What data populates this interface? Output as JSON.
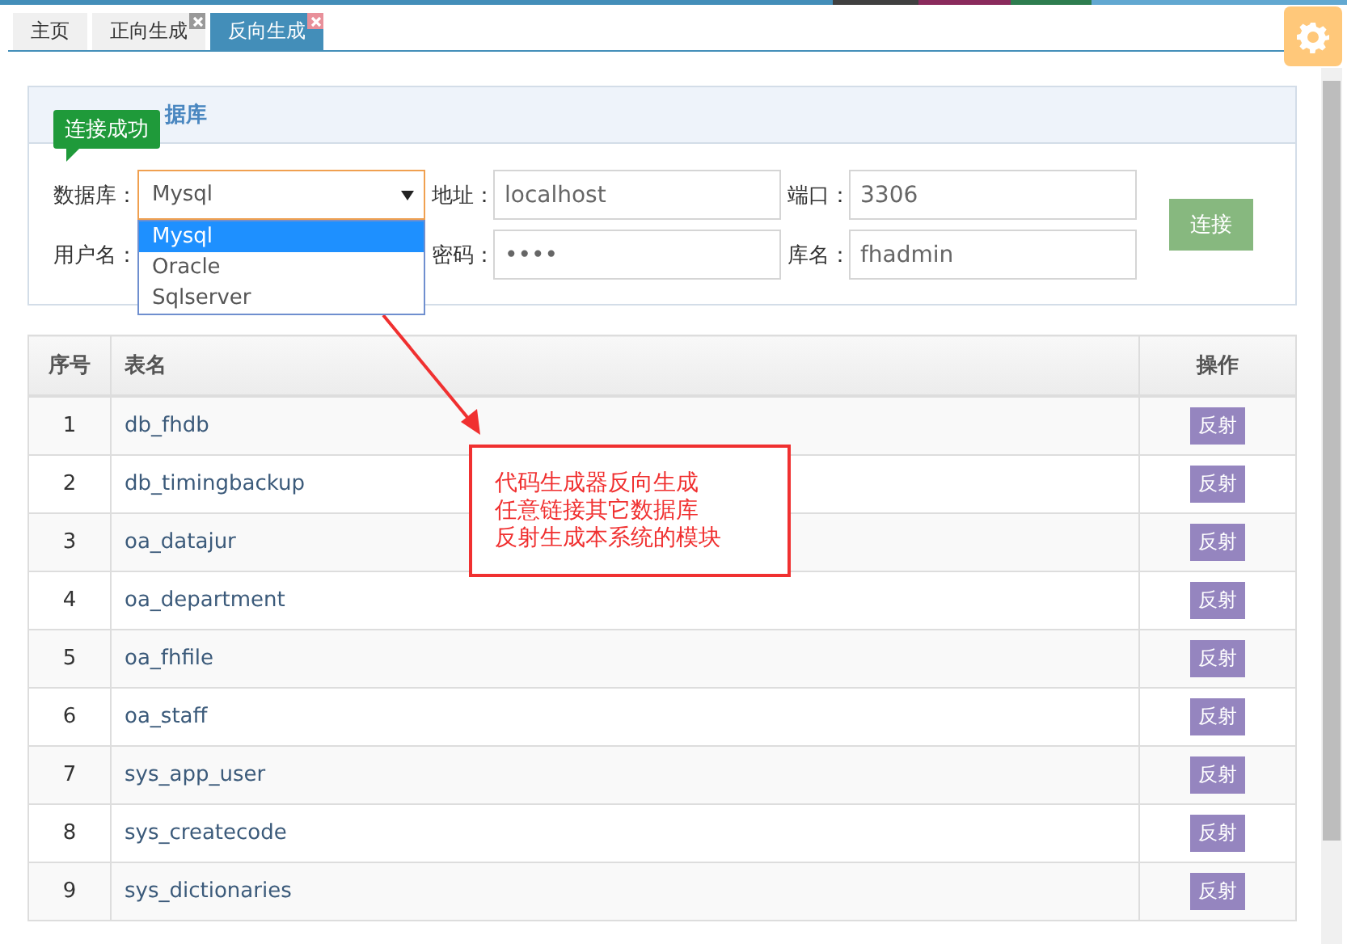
{
  "tabs": [
    {
      "label": "主页",
      "selected": false,
      "closable": false
    },
    {
      "label": "正向生成",
      "selected": false,
      "closable": true
    },
    {
      "label": "反向生成",
      "selected": true,
      "closable": true
    }
  ],
  "panel": {
    "title": "据库",
    "tooltip": "连接成功",
    "rows": [
      [
        {
          "label": "数据库：",
          "kind": "select",
          "value": "Mysql",
          "expanded": true,
          "options": [
            {
              "label": "Mysql",
              "selected": true
            },
            {
              "label": "Oracle",
              "selected": false
            },
            {
              "label": "Sqlserver",
              "selected": false
            }
          ]
        },
        {
          "label": "地址：",
          "kind": "input",
          "value": "localhost"
        },
        {
          "label": "端口：",
          "kind": "input",
          "value": "3306"
        }
      ],
      [
        {
          "label": "用户名：",
          "kind": "covered"
        },
        {
          "label": "密码：",
          "kind": "input",
          "value": "••••"
        },
        {
          "label": "库名：",
          "kind": "input",
          "value": "fhadmin"
        }
      ]
    ],
    "button": "连接"
  },
  "table": {
    "columns": [
      "序号",
      "表名",
      "操作"
    ],
    "rows": [
      {
        "no": "1",
        "name": "db_fhdb",
        "action": "反射"
      },
      {
        "no": "2",
        "name": "db_timingbackup",
        "action": "反射"
      },
      {
        "no": "3",
        "name": "oa_datajur",
        "action": "反射"
      },
      {
        "no": "4",
        "name": "oa_department",
        "action": "反射"
      },
      {
        "no": "5",
        "name": "oa_fhfile",
        "action": "反射"
      },
      {
        "no": "6",
        "name": "oa_staff",
        "action": "反射"
      },
      {
        "no": "7",
        "name": "sys_app_user",
        "action": "反射"
      },
      {
        "no": "8",
        "name": "sys_createcode",
        "action": "反射"
      },
      {
        "no": "9",
        "name": "sys_dictionaries",
        "action": "反射"
      }
    ]
  },
  "annotation": {
    "lines": [
      "代码生成器反向生成",
      "任意链接其它数据库",
      "反射生成本系统的模块"
    ]
  }
}
